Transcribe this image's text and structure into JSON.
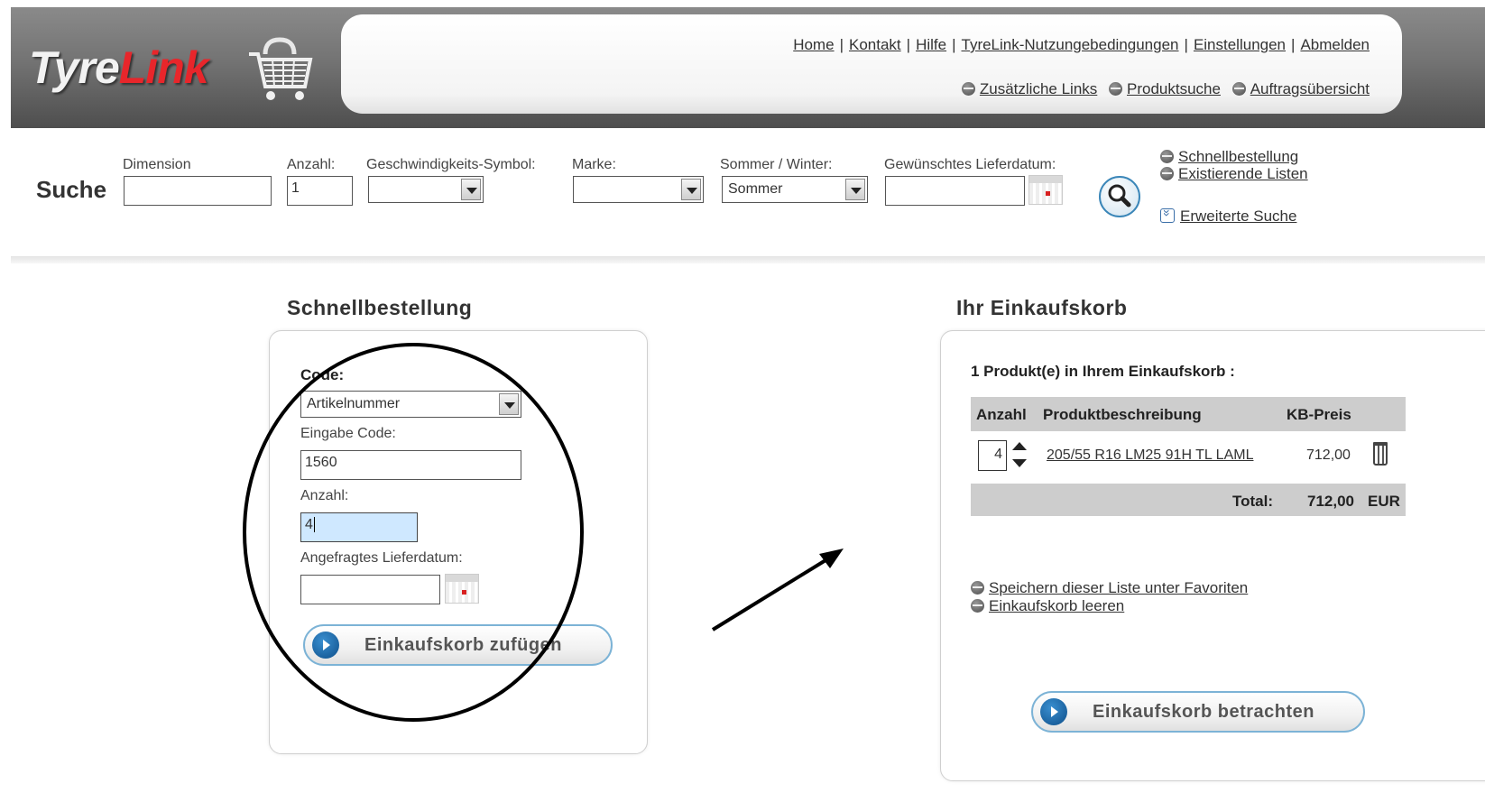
{
  "brand": {
    "name_part1": "Tyre",
    "name_part2": "Link"
  },
  "top_nav": {
    "links": [
      "Home",
      "Kontakt",
      "Hilfe",
      "TyreLink-Nutzungebedingungen",
      "Einstellungen",
      "Abmelden"
    ],
    "separator": "|",
    "sub_links": [
      "Zusätzliche Links",
      "Produktsuche",
      "Auftragsübersicht"
    ]
  },
  "search": {
    "title": "Suche",
    "dimension_label": "Dimension",
    "dimension_value": "",
    "anzahl_label": "Anzahl:",
    "anzahl_value": "1",
    "speed_label": "Geschwindigkeits-Symbol:",
    "speed_value": "",
    "marke_label": "Marke:",
    "marke_value": "",
    "season_label": "Sommer / Winter:",
    "season_value": "Sommer",
    "delivery_label": "Gewünschtes Lieferdatum:",
    "delivery_value": "",
    "links": {
      "quick_order": "Schnellbestellung",
      "existing_lists": "Existierende Listen",
      "advanced": "Erweiterte Suche"
    }
  },
  "quick_order": {
    "title": "Schnellbestellung",
    "code_label": "Code:",
    "code_value": "Artikelnummer",
    "input_code_label": "Eingabe Code:",
    "input_code_value": "1560",
    "quantity_label": "Anzahl:",
    "quantity_value": "4",
    "date_label": "Angefragtes Lieferdatum:",
    "date_value": "",
    "add_button": "Einkaufskorb zufügen"
  },
  "cart": {
    "title": "Ihr Einkaufskorb",
    "summary": "1 Produkt(e) in Ihrem Einkaufskorb  :",
    "columns": {
      "qty": "Anzahl",
      "desc": "Produktbeschreibung",
      "price": "KB-Preis"
    },
    "items": [
      {
        "qty": "4",
        "description": "205/55 R16 LM25 91H TL LAML",
        "price": "712,00"
      }
    ],
    "total_label": "Total:",
    "total_value": "712,00",
    "currency": "EUR",
    "save_link": "Speichern dieser Liste unter Favoriten",
    "empty_link": "Einkaufskorb leeren",
    "view_button": "Einkaufskorb betrachten"
  },
  "colors": {
    "header_gray": "#6e6e6e",
    "brand_red": "#e8262b",
    "button_blue": "#0e4f8a",
    "table_gray": "#cdcdcd",
    "focus_field": "#cfe8ff"
  },
  "annotations": {
    "circle": "hand-drawn-ellipse",
    "arrow": "arrow-to-cart"
  }
}
